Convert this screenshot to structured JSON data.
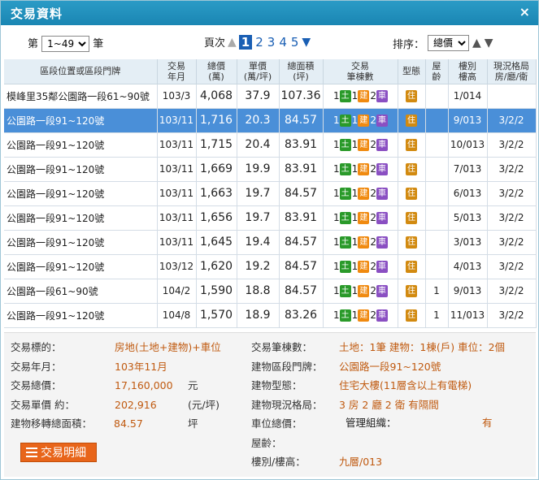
{
  "window": {
    "title": "交易資料",
    "close_label": "×"
  },
  "toolbar": {
    "range_prefix": "第",
    "range_value": "1~49",
    "range_suffix": "筆",
    "pager_label": "頁次",
    "pages": [
      "1",
      "2",
      "3",
      "4",
      "5"
    ],
    "current_page": "1",
    "sort_label": "排序：",
    "sort_value": "總價"
  },
  "table": {
    "headers": [
      "區段位置或區段門牌",
      "交易\n年月",
      "總價\n(萬)",
      "單價\n(萬/坪)",
      "總面積\n(坪)",
      "交易\n筆棟數",
      "型態",
      "屋\n齡",
      "樓別\n樓高",
      "現況格局\n房/廳/衛"
    ],
    "tag_labels": {
      "land": "土",
      "building": "建",
      "parking": "車",
      "type": "住"
    },
    "rows": [
      {
        "addr": "模峰里35鄰公園路一段61~90號",
        "ym": "103/3",
        "total": "4,068",
        "unit": "37.9",
        "area": "107.36",
        "land": "1",
        "bldg": "1",
        "park": "2",
        "age": "",
        "floor": "1/014",
        "layout": ""
      },
      {
        "addr": "公園路一段91~120號",
        "ym": "103/11",
        "total": "1,716",
        "unit": "20.3",
        "area": "84.57",
        "land": "1",
        "bldg": "1",
        "park": "2",
        "age": "",
        "floor": "9/013",
        "layout": "3/2/2"
      },
      {
        "addr": "公園路一段91~120號",
        "ym": "103/11",
        "total": "1,715",
        "unit": "20.4",
        "area": "83.91",
        "land": "1",
        "bldg": "1",
        "park": "2",
        "age": "",
        "floor": "10/013",
        "layout": "3/2/2"
      },
      {
        "addr": "公園路一段91~120號",
        "ym": "103/11",
        "total": "1,669",
        "unit": "19.9",
        "area": "83.91",
        "land": "1",
        "bldg": "1",
        "park": "2",
        "age": "",
        "floor": "7/013",
        "layout": "3/2/2"
      },
      {
        "addr": "公園路一段91~120號",
        "ym": "103/11",
        "total": "1,663",
        "unit": "19.7",
        "area": "84.57",
        "land": "1",
        "bldg": "1",
        "park": "2",
        "age": "",
        "floor": "6/013",
        "layout": "3/2/2"
      },
      {
        "addr": "公園路一段91~120號",
        "ym": "103/11",
        "total": "1,656",
        "unit": "19.7",
        "area": "83.91",
        "land": "1",
        "bldg": "1",
        "park": "2",
        "age": "",
        "floor": "5/013",
        "layout": "3/2/2"
      },
      {
        "addr": "公園路一段91~120號",
        "ym": "103/11",
        "total": "1,645",
        "unit": "19.4",
        "area": "84.57",
        "land": "1",
        "bldg": "1",
        "park": "2",
        "age": "",
        "floor": "3/013",
        "layout": "3/2/2"
      },
      {
        "addr": "公園路一段91~120號",
        "ym": "103/12",
        "total": "1,620",
        "unit": "19.2",
        "area": "84.57",
        "land": "1",
        "bldg": "1",
        "park": "2",
        "age": "",
        "floor": "4/013",
        "layout": "3/2/2"
      },
      {
        "addr": "公園路一段61~90號",
        "ym": "104/2",
        "total": "1,590",
        "unit": "18.8",
        "area": "84.57",
        "land": "1",
        "bldg": "1",
        "park": "2",
        "age": "1",
        "floor": "9/013",
        "layout": "3/2/2"
      },
      {
        "addr": "公園路一段91~120號",
        "ym": "104/8",
        "total": "1,570",
        "unit": "18.9",
        "area": "83.26",
        "land": "1",
        "bldg": "1",
        "park": "2",
        "age": "1",
        "floor": "11/013",
        "layout": "3/2/2"
      }
    ]
  },
  "detail": {
    "left": [
      {
        "label": "交易標的：",
        "value": "房地(土地+建物)+車位",
        "unit": ""
      },
      {
        "label": "交易年月：",
        "value": "103年11月",
        "unit": ""
      },
      {
        "label": "交易總價：",
        "value": "17,160,000",
        "unit": "元"
      },
      {
        "label": "交易單價 約：",
        "value": "202,916",
        "unit": "(元/坪)"
      },
      {
        "label": "建物移轉總面積：",
        "value": "84.57",
        "unit": "坪"
      }
    ],
    "right": [
      {
        "label": "交易筆棟數：",
        "value": "土地：1筆 建物：1棟(戶) 車位：2個"
      },
      {
        "label": "建物區段門牌：",
        "value": "公園路一段91~120號"
      },
      {
        "label": "建物型態：",
        "value": "住宅大樓(11層含以上有電梯)"
      },
      {
        "label": "建物現況格局：",
        "value": "3 房 2 廳 2 衛 有隔間"
      },
      {
        "label": "車位總價：",
        "value": ""
      },
      {
        "label": "屋齡：",
        "value": ""
      },
      {
        "label": "樓別/樓高：",
        "value": "九層/013"
      }
    ],
    "mgmt_label": "管理組織：",
    "mgmt_value": "有",
    "button_label": "交易明細"
  }
}
